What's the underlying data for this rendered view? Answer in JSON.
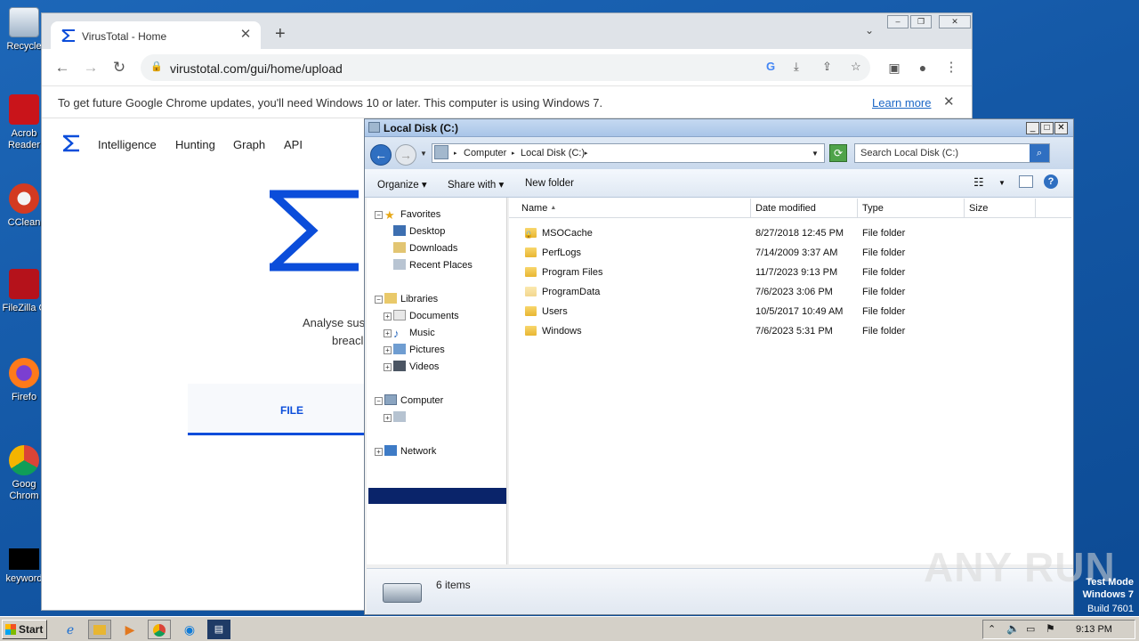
{
  "desktop": {
    "icons": [
      {
        "label": "Recycle",
        "icon": "recycle-bin-icon"
      },
      {
        "label": "Acrob Reader",
        "icon": "acrobat-icon"
      },
      {
        "label": "CClean",
        "icon": "ccleaner-icon"
      },
      {
        "label": "FileZilla C",
        "icon": "filezilla-icon"
      },
      {
        "label": "Firefo",
        "icon": "firefox-icon"
      },
      {
        "label": "Goog Chrom",
        "icon": "chrome-icon"
      },
      {
        "label": "keyword",
        "icon": "keyword-file-icon"
      }
    ],
    "watermark": {
      "line1": "Test Mode",
      "line2": "Windows 7",
      "line3": "Build 7601"
    },
    "anyrun": "ANY RUN"
  },
  "chrome": {
    "tab_title": "VirusTotal - Home",
    "url": "virustotal.com/gui/home/upload",
    "infobar_message": "To get future Google Chrome updates, you'll need Windows 10 or later. This computer is using Windows 7.",
    "infobar_link": "Learn more",
    "nav": [
      "Intelligence",
      "Hunting",
      "Graph",
      "API"
    ],
    "analyse_text": "Analyse sus",
    "breach_text": "breacl",
    "file_tab": "FILE"
  },
  "explorer": {
    "title": "Local Disk (C:)",
    "breadcrumb": [
      "Computer",
      "Local Disk (C:)"
    ],
    "search_placeholder": "Search Local Disk (C:)",
    "commands": [
      "Organize",
      "Share with",
      "New folder"
    ],
    "tree": {
      "favorites": "Favorites",
      "favorite_items": [
        "Desktop",
        "Downloads",
        "Recent Places"
      ],
      "libraries": "Libraries",
      "library_items": [
        "Documents",
        "Music",
        "Pictures",
        "Videos"
      ],
      "computer": "Computer",
      "selected": "Local Disk (C:)",
      "network": "Network"
    },
    "columns": [
      "Name",
      "Date modified",
      "Type",
      "Size"
    ],
    "rows": [
      {
        "name": "MSOCache",
        "date": "8/27/2018 12:45 PM",
        "type": "File folder",
        "locked": true
      },
      {
        "name": "PerfLogs",
        "date": "7/14/2009 3:37 AM",
        "type": "File folder"
      },
      {
        "name": "Program Files",
        "date": "11/7/2023 9:13 PM",
        "type": "File folder"
      },
      {
        "name": "ProgramData",
        "date": "7/6/2023 3:06 PM",
        "type": "File folder"
      },
      {
        "name": "Users",
        "date": "10/5/2017 10:49 AM",
        "type": "File folder"
      },
      {
        "name": "Windows",
        "date": "7/6/2023 5:31 PM",
        "type": "File folder"
      }
    ],
    "status_count": "6 items"
  },
  "taskbar": {
    "start_label": "Start",
    "clock": "9:13 PM"
  }
}
